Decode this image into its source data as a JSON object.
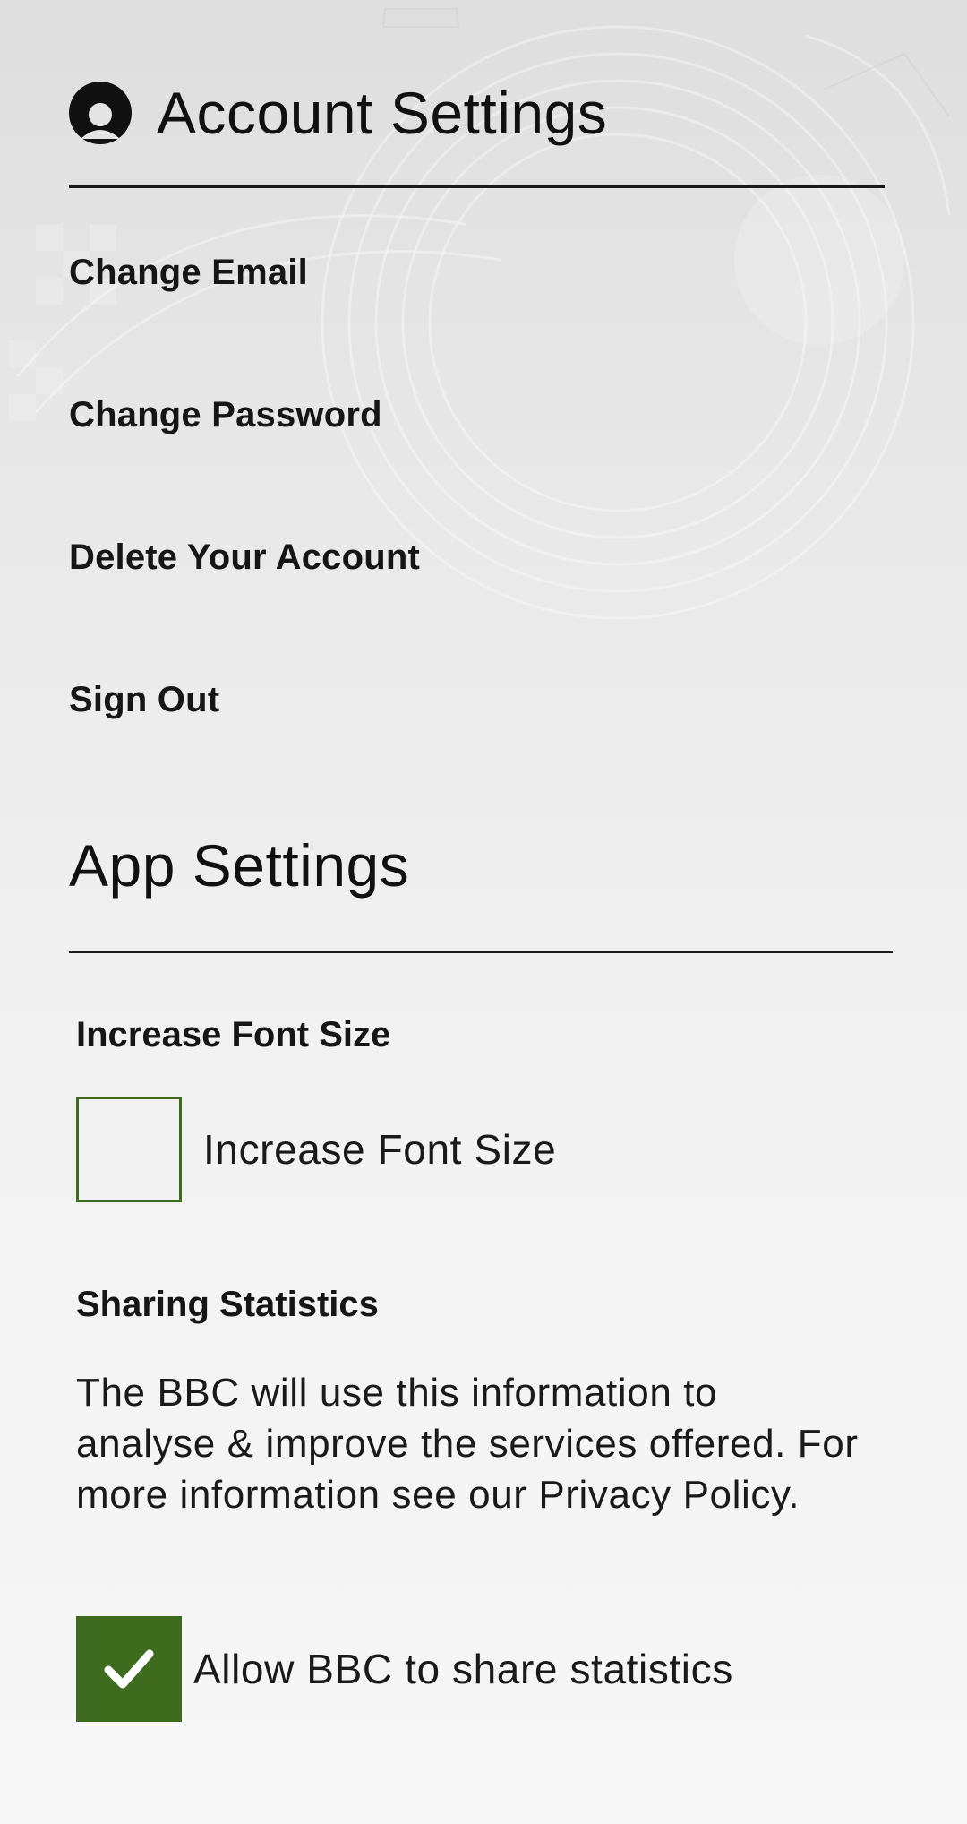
{
  "colors": {
    "accent": "#3f6b1f",
    "text": "#111111",
    "divider": "#1a1a1a"
  },
  "account": {
    "icon": "account-circle-icon",
    "title": "Account Settings",
    "items": [
      {
        "label": "Change Email"
      },
      {
        "label": "Change Password"
      },
      {
        "label": "Delete Your Account"
      },
      {
        "label": "Sign Out"
      }
    ]
  },
  "app_settings": {
    "title": "App Settings",
    "font_size": {
      "heading": "Increase Font Size",
      "checkbox_label": "Increase Font Size",
      "checked": false
    },
    "sharing": {
      "heading": "Sharing Statistics",
      "description": "The BBC will use this information to analyse & improve the services offered. For more information see our Privacy Policy.",
      "checkbox_label": "Allow BBC to share statistics",
      "checked": true,
      "check_icon": "checkmark-icon"
    }
  }
}
